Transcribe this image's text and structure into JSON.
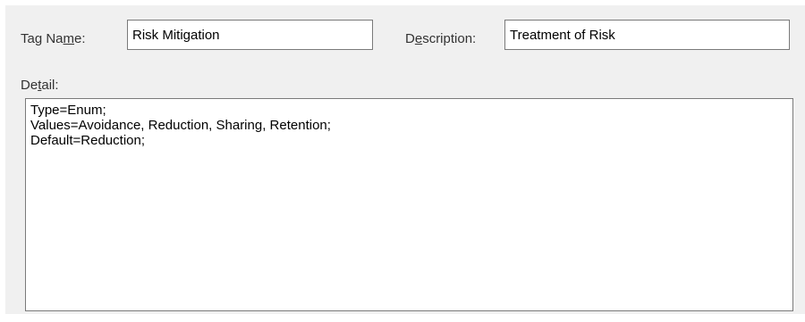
{
  "form": {
    "tag_name_label_pre": "Tag Na",
    "tag_name_label_accel": "m",
    "tag_name_label_post": "e:",
    "tag_name_value": "Risk Mitigation",
    "description_label_pre": "D",
    "description_label_accel": "e",
    "description_label_post": "scription:",
    "description_value": "Treatment of Risk",
    "detail_label_pre": "De",
    "detail_label_accel": "t",
    "detail_label_post": "ail:",
    "detail_value": "Type=Enum;\nValues=Avoidance, Reduction, Sharing, Retention;\nDefault=Reduction;"
  }
}
